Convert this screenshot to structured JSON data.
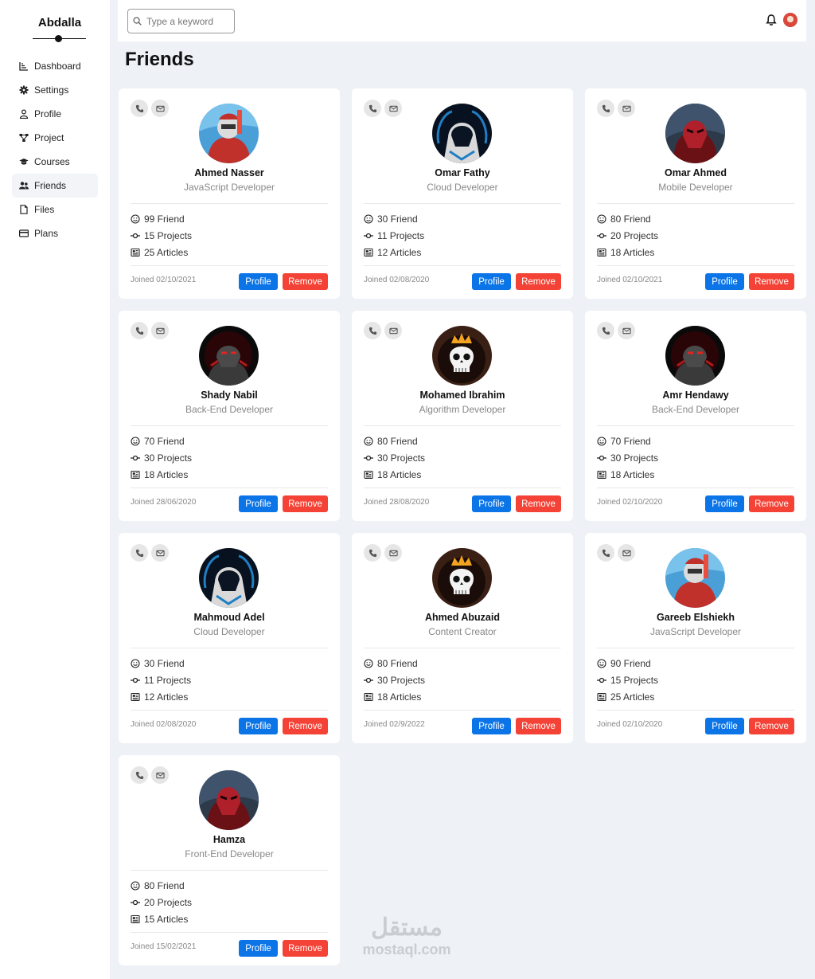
{
  "sidebar": {
    "brand": "Abdalla",
    "items": [
      {
        "label": "Dashboard",
        "icon": "chart-icon"
      },
      {
        "label": "Settings",
        "icon": "gear-icon"
      },
      {
        "label": "Profile",
        "icon": "user-icon"
      },
      {
        "label": "Project",
        "icon": "diagram-icon"
      },
      {
        "label": "Courses",
        "icon": "graduation-cap-icon"
      },
      {
        "label": "Friends",
        "icon": "users-icon",
        "active": true
      },
      {
        "label": "Files",
        "icon": "file-icon"
      },
      {
        "label": "Plans",
        "icon": "credit-card-icon"
      }
    ]
  },
  "header": {
    "search_placeholder": "Type a keyword",
    "search_value": ""
  },
  "page": {
    "title": "Friends"
  },
  "buttons": {
    "profile": "Profile",
    "remove": "Remove"
  },
  "colors": {
    "profile_button": "#0b75e8",
    "remove_button": "#f44336",
    "background": "#eef1f6"
  },
  "friends": [
    {
      "name": "Ahmed Nasser",
      "job": "JavaScript Developer",
      "friends": "99 Friend",
      "projects": "15 Projects",
      "articles": "25 Articles",
      "joined": "Joined 02/10/2021",
      "avatar": "red-ninja-avatar"
    },
    {
      "name": "Omar Fathy",
      "job": "Cloud Developer",
      "friends": "30 Friend",
      "projects": "11 Projects",
      "articles": "12 Articles",
      "joined": "Joined 02/08/2020",
      "avatar": "hooded-blue-avatar"
    },
    {
      "name": "Omar Ahmed",
      "job": "Mobile Developer",
      "friends": "80 Friend",
      "projects": "20 Projects",
      "articles": "18 Articles",
      "joined": "Joined 02/10/2021",
      "avatar": "red-mask-avatar"
    },
    {
      "name": "Shady Nabil",
      "job": "Back-End Developer",
      "friends": "70 Friend",
      "projects": "30 Projects",
      "articles": "18 Articles",
      "joined": "Joined 28/06/2020",
      "avatar": "dark-knight-avatar"
    },
    {
      "name": "Mohamed Ibrahim",
      "job": "Algorithm Developer",
      "friends": "80 Friend",
      "projects": "30 Projects",
      "articles": "18 Articles",
      "joined": "Joined 28/08/2020",
      "avatar": "crowned-skull-avatar"
    },
    {
      "name": "Amr Hendawy",
      "job": "Back-End Developer",
      "friends": "70 Friend",
      "projects": "30 Projects",
      "articles": "18 Articles",
      "joined": "Joined 02/10/2020",
      "avatar": "dark-knight-avatar"
    },
    {
      "name": "Mahmoud Adel",
      "job": "Cloud Developer",
      "friends": "30 Friend",
      "projects": "11 Projects",
      "articles": "12 Articles",
      "joined": "Joined 02/08/2020",
      "avatar": "hooded-blue-avatar"
    },
    {
      "name": "Ahmed Abuzaid",
      "job": "Content Creator",
      "friends": "80 Friend",
      "projects": "30 Projects",
      "articles": "18 Articles",
      "joined": "Joined 02/9/2022",
      "avatar": "crowned-skull-avatar"
    },
    {
      "name": "Gareeb Elshiekh",
      "job": "JavaScript Developer",
      "friends": "90 Friend",
      "projects": "15 Projects",
      "articles": "25 Articles",
      "joined": "Joined 02/10/2020",
      "avatar": "red-ninja-avatar"
    },
    {
      "name": "Hamza",
      "job": "Front-End Developer",
      "friends": "80 Friend",
      "projects": "20 Projects",
      "articles": "15 Articles",
      "joined": "Joined 15/02/2021",
      "avatar": "red-mask-avatar"
    }
  ],
  "watermark": {
    "arabic": "مستقل",
    "latin": "mostaql.com"
  }
}
